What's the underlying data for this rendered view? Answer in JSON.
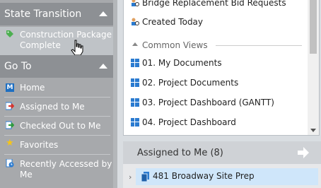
{
  "left_panel": {
    "state_transition": {
      "title": "State Transition",
      "items": [
        {
          "label_line1": "Construction Package",
          "label_line2": "Complete"
        }
      ]
    },
    "go_to": {
      "title": "Go To",
      "items": [
        {
          "label": "Home",
          "icon": "home-m-icon"
        },
        {
          "label": "Assigned to Me",
          "icon": "assigned-arrow-icon"
        },
        {
          "label": "Checked Out to Me",
          "icon": "checked-out-icon"
        },
        {
          "label": "Favorites",
          "icon": "star-icon"
        },
        {
          "label_line1": "Recently Accessed by",
          "label_line2": "Me",
          "icon": "recent-icon"
        }
      ]
    }
  },
  "views_panel": {
    "items_top": [
      {
        "label": "Bridge Replacement Bid Requests",
        "icon": "saved-search-icon"
      },
      {
        "label": "Created Today",
        "icon": "saved-search-icon"
      }
    ],
    "common_views_label": "Common Views",
    "common_views": [
      {
        "label": "01. My Documents"
      },
      {
        "label": "02. Project Documents"
      },
      {
        "label": "03. Project Dashboard (GANTT)"
      },
      {
        "label": "04. Project Dashboard"
      }
    ]
  },
  "assigned_panel": {
    "title": "Assigned to Me (8)",
    "first_item": "481 Broadway Site Prep"
  },
  "colors": {
    "left_bg": "#a7a9ac",
    "header_bg": "#8d9094",
    "grid_icon": "#2b7bd0",
    "highlight": "#cfe6fa"
  }
}
